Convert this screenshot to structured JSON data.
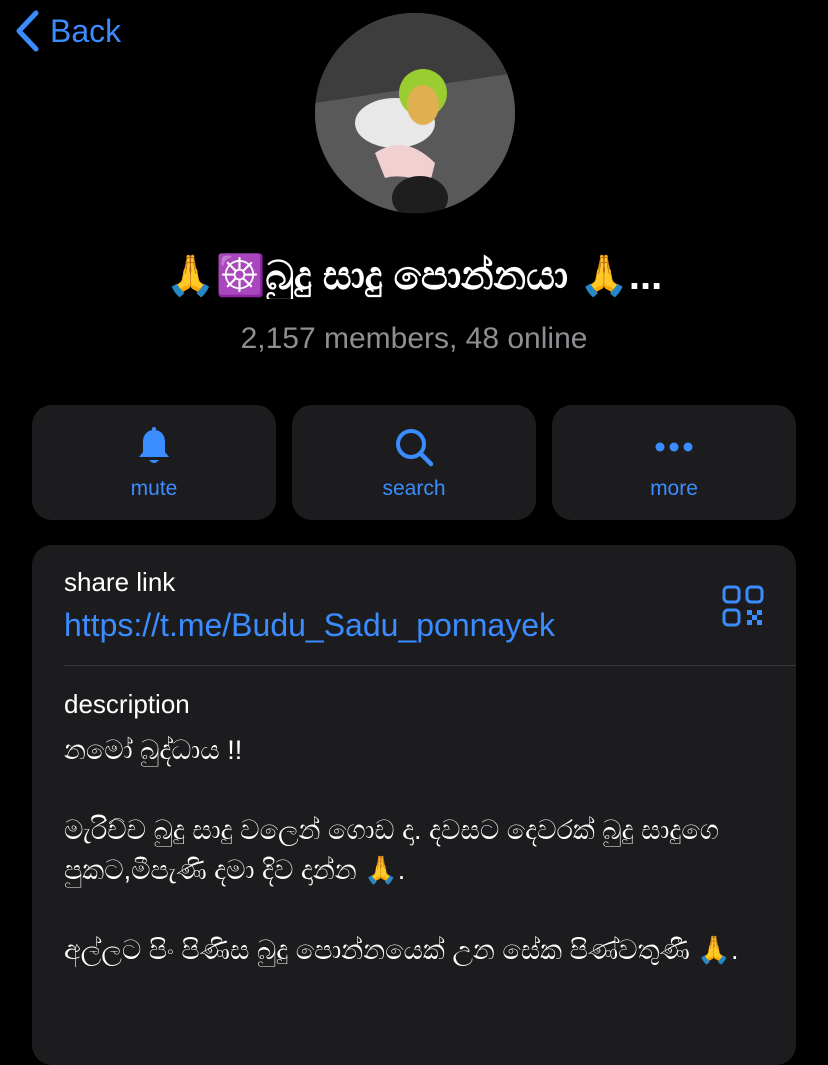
{
  "nav": {
    "back_label": "Back"
  },
  "header": {
    "title": "🙏☸️බුදු සාදු පොන්නයා 🙏...",
    "subtitle": "2,157 members, 48 online"
  },
  "actions": [
    {
      "label": "mute",
      "icon": "bell-icon"
    },
    {
      "label": "search",
      "icon": "search-icon"
    },
    {
      "label": "more",
      "icon": "more-icon"
    }
  ],
  "info": {
    "share_label": "share link",
    "share_link": "https://t.me/Budu_Sadu_ponnayek",
    "description_label": "description",
    "description": [
      "නමෝ බුද්ධාය !!",
      "මැරිච්ච බුදු සාදු වලෙන් ගොඩ දා. දවසට දෙවරක් බුදු සාදුගෙ පුකට,මීපැණි දමා දිව දාන්න 🙏.",
      "අල්ලට පිං පිණිස බුදු පොන්නයෙක් උන සේක පිණ්වතුණී 🙏."
    ]
  },
  "colors": {
    "accent": "#3a8cff",
    "background": "#000000",
    "card": "#1c1c1e",
    "secondary_text": "#8e8e93"
  }
}
